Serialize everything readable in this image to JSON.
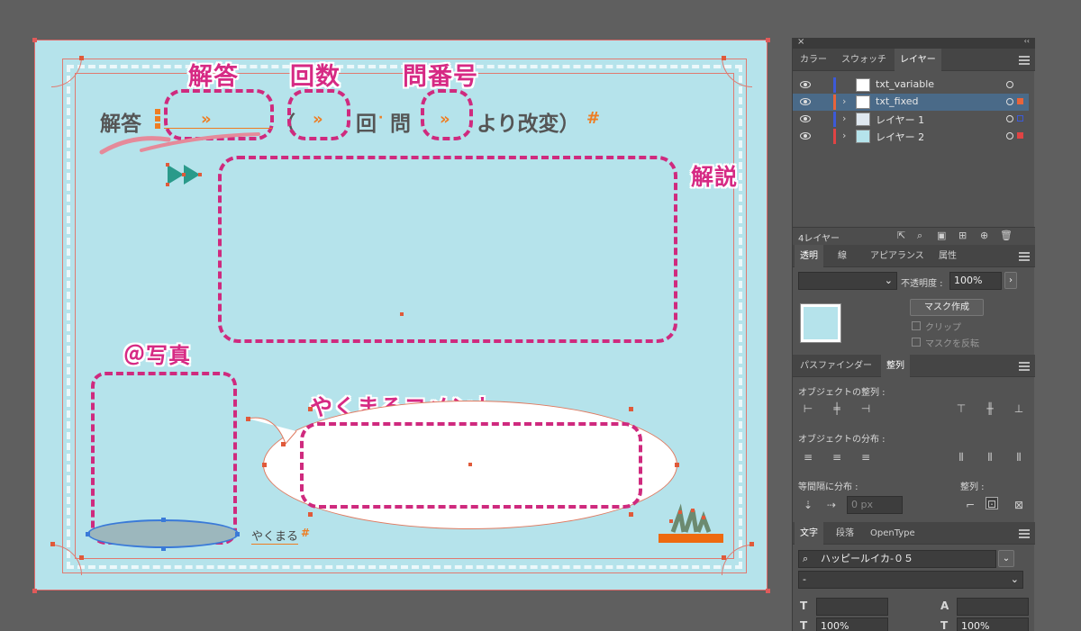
{
  "artboard": {
    "labels": {
      "answer_title": "解答",
      "count_title": "回数",
      "qnum_title": "問番号",
      "commentary": "解説",
      "photo": "＠写真",
      "yakumaru_comment": "やくまるコメント"
    },
    "template_line": {
      "answer": "解答",
      "open_paren": "（",
      "kai": "回",
      "dot": "·",
      "mon": "問",
      "modified": "より改変）",
      "placeholder": "»",
      "hash": "#"
    },
    "yakumaru_tag": "やくまる",
    "yakumaru_hash": "#"
  },
  "panel": {
    "top_bar": {
      "close": "×",
      "collapse": "‹‹"
    },
    "layers_tabs": [
      "カラー",
      "スウォッチ",
      "レイヤー"
    ],
    "layers_active_tab": 2,
    "layers": [
      {
        "name": "txt_variable",
        "color": "#3c5ad8",
        "selected": false,
        "expand": ""
      },
      {
        "name": "txt_fixed",
        "color": "#e8643a",
        "selected": true,
        "expand": "›"
      },
      {
        "name": "レイヤー 1",
        "color": "#3c5ad8",
        "selected": false,
        "expand": "›"
      },
      {
        "name": "レイヤー 2",
        "color": "#e04444",
        "selected": false,
        "expand": "›"
      }
    ],
    "layer_count": "4レイヤー",
    "transparency_tabs": [
      "透明",
      "線",
      "アピアランス",
      "属性"
    ],
    "blend_mode": "",
    "opacity_label": "不透明度 :",
    "opacity_value": "100%",
    "mask_button": "マスク作成",
    "clip_label": "クリップ",
    "invert_mask_label": "マスクを反転",
    "align_tabs": [
      "パスファインダー",
      "整列"
    ],
    "align_objects_label": "オブジェクトの整列 :",
    "distribute_objects_label": "オブジェクトの分布 :",
    "distribute_spacing_label": "等間隔に分布 :",
    "align_to_label": "整列 :",
    "spacing_value": "0 px",
    "type_tabs": [
      "文字",
      "段落",
      "OpenType"
    ],
    "font_name": "ハッピールイカ-０５",
    "font_style": "-",
    "leading_value": "100%",
    "tracking_value": "100%"
  }
}
